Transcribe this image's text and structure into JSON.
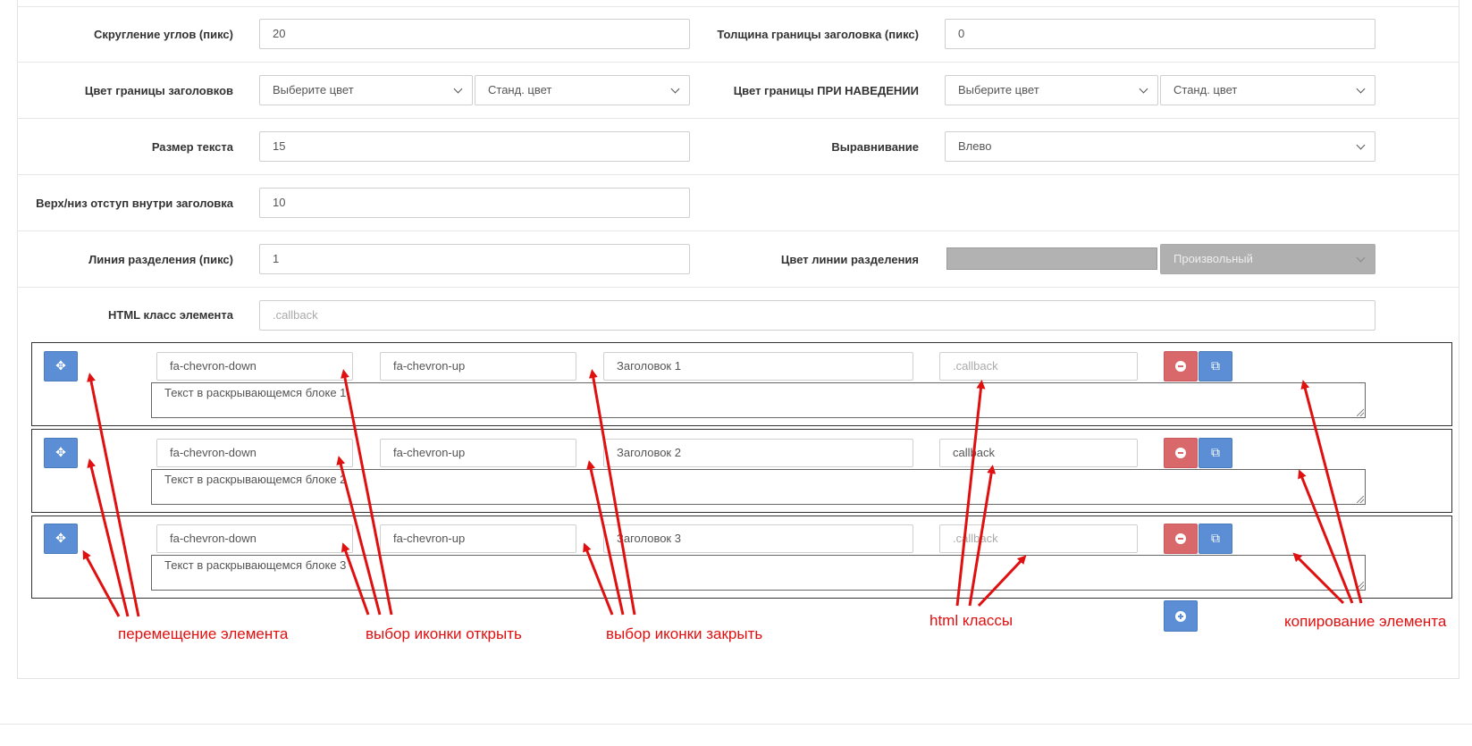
{
  "settings": {
    "corner_radius": {
      "label": "Скругление углов (пикс)",
      "value": "20"
    },
    "header_border_width": {
      "label": "Толщина границы заголовка (пикс)",
      "value": "0"
    },
    "header_border_color": {
      "label": "Цвет границы заголовков",
      "select1": "Выберите цвет",
      "select2": "Станд. цвет"
    },
    "hover_border_color": {
      "label": "Цвет границы ПРИ НАВЕДЕНИИ",
      "select1": "Выберите цвет",
      "select2": "Станд. цвет"
    },
    "text_size": {
      "label": "Размер текста",
      "value": "15"
    },
    "alignment": {
      "label": "Выравнивание",
      "value": "Влево"
    },
    "header_padding": {
      "label": "Верх/низ отступ внутри заголовка",
      "value": "10"
    },
    "separator_line": {
      "label": "Линия разделения (пикс)",
      "value": "1"
    },
    "separator_color": {
      "label": "Цвет линии разделения",
      "select": "Произвольный",
      "swatch_color": "#b2b2b2"
    },
    "html_class": {
      "label": "HTML класс элемента",
      "placeholder": ".callback"
    }
  },
  "items": [
    {
      "icon_open": "fa-chevron-down",
      "icon_close": "fa-chevron-up",
      "title": "Заголовок 1",
      "css_class": "",
      "css_placeholder": ".callback",
      "text": "Текст в раскрывающемся блоке 1"
    },
    {
      "icon_open": "fa-chevron-down",
      "icon_close": "fa-chevron-up",
      "title": "Заголовок 2",
      "css_class": "callback",
      "css_placeholder": ".callback",
      "text": "Текст в раскрывающемся блоке 2"
    },
    {
      "icon_open": "fa-chevron-down",
      "icon_close": "fa-chevron-up",
      "title": "Заголовок 3",
      "css_class": "",
      "css_placeholder": ".callback",
      "text": "Текст в раскрывающемся блоке 3"
    }
  ],
  "annotations": {
    "move": "перемещение элемента",
    "icon_open": "выбор иконки открыть",
    "icon_close": "выбор иконки закрыть",
    "html_classes": "html классы",
    "copy": "копирование элемента"
  },
  "colors": {
    "primary": "#5b8ed4",
    "danger": "#d9686b",
    "annotation": "#e01010"
  },
  "icons": {
    "move": "move-icon",
    "remove": "minus-circle-icon",
    "copy": "copy-icon",
    "add": "plus-circle-icon"
  }
}
